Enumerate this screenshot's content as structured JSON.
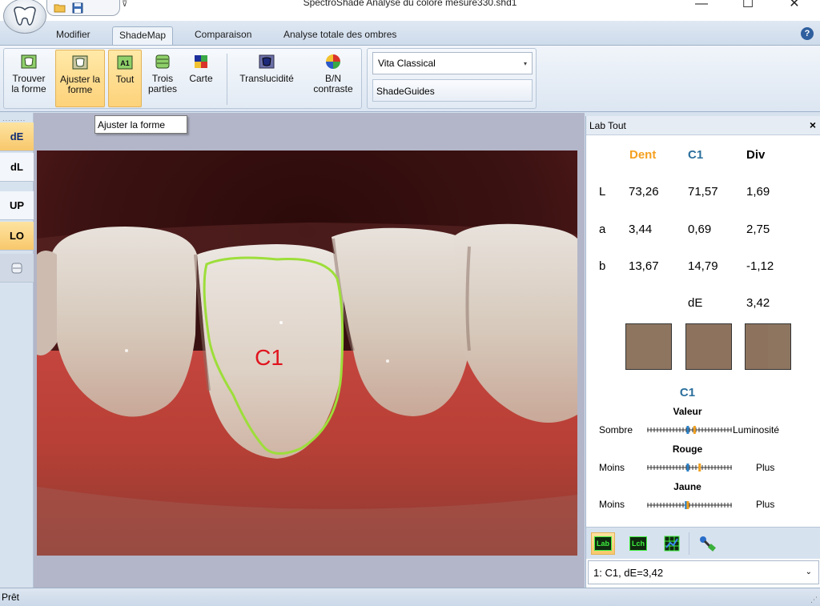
{
  "window": {
    "title": "SpectroShade Analyse du coloré   mesure330.shd1",
    "minimize": "—",
    "maximize": "☐",
    "close": "✕"
  },
  "quick_access": {
    "more": "⊽"
  },
  "tabs": [
    {
      "label": "Modifier"
    },
    {
      "label": "ShadeMap",
      "active": true
    },
    {
      "label": "Comparaison"
    },
    {
      "label": "Analyse totale des ombres"
    }
  ],
  "help_label": "?",
  "ribbon": {
    "buttons": [
      {
        "line1": "Trouver",
        "line2": "la forme"
      },
      {
        "line1": "Ajuster la",
        "line2": "forme"
      },
      {
        "line1": "Tout",
        "line2": ""
      },
      {
        "line1": "Trois",
        "line2": "parties"
      },
      {
        "line1": "Carte",
        "line2": ""
      },
      {
        "line1": "Translucidité",
        "line2": ""
      },
      {
        "line1": "B/N",
        "line2": "contraste"
      }
    ],
    "shade_guide_value": "Vita Classical",
    "shadeguides_button": "ShadeGuides"
  },
  "tooltip": "Ajuster la forme",
  "left_toolbar": [
    {
      "label": "dE"
    },
    {
      "label": "dL"
    },
    {
      "label": "UP"
    },
    {
      "label": "LO"
    }
  ],
  "image": {
    "region_label": "C1",
    "outline_color": "#9dde3a",
    "label_color": "#e0141e"
  },
  "lab_panel": {
    "title": "Lab Tout",
    "close": "×",
    "columns": {
      "dent": "Dent",
      "c1": "C1",
      "div": "Div"
    },
    "colors": {
      "dent": "#f5a020",
      "c1": "#2b6f9c",
      "div": "#000000"
    },
    "rows": [
      {
        "label": "L",
        "dent": "73,26",
        "c1": "71,57",
        "div": "1,69"
      },
      {
        "label": "a",
        "dent": "3,44",
        "c1": "0,69",
        "div": "2,75"
      },
      {
        "label": "b",
        "dent": "13,67",
        "c1": "14,79",
        "div": "-1,12"
      }
    ],
    "de_label": "dE",
    "de_value": "3,42",
    "swatch_color": "#8d7560",
    "subtitle": "C1",
    "scales": [
      {
        "title": "Valeur",
        "left": "Sombre",
        "right": "Luminosité",
        "level_blue": 0.48,
        "level_orange": 0.56
      },
      {
        "title": "Rouge",
        "left": "Moins",
        "right": "Plus",
        "level_blue": 0.48,
        "level_orange": 0.62
      },
      {
        "title": "Jaune",
        "left": "Moins",
        "right": "Plus",
        "level_blue": 0.46,
        "level_orange": 0.48
      }
    ],
    "bottom_tabs": [
      {
        "label": "Lab",
        "active": true
      },
      {
        "label": "Lch"
      },
      {
        "label": ""
      },
      {
        "label": ""
      }
    ],
    "measure_select": "1: C1,  dE=3,42"
  },
  "status": "Prêt"
}
